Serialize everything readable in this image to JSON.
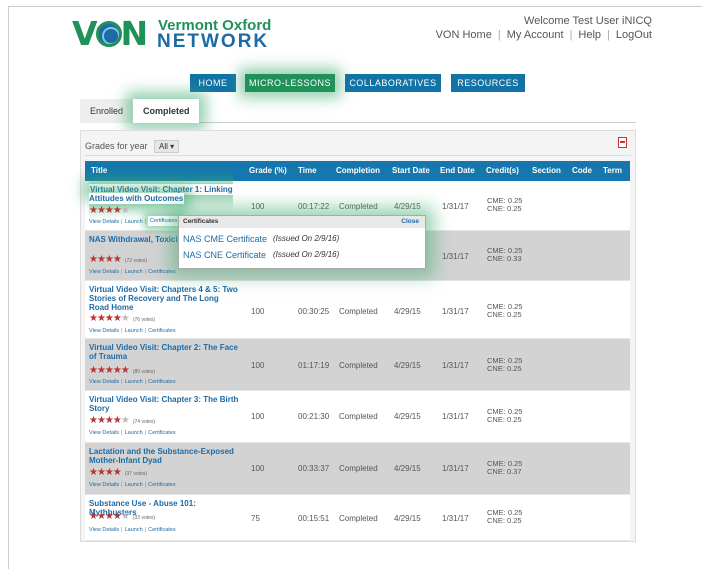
{
  "header": {
    "logo_mark": "V N",
    "logo_line1": "Vermont Oxford",
    "logo_line2": "NETWORK",
    "welcome": "Welcome Test User iNICQ",
    "links": [
      "VON Home",
      "My Account",
      "Help",
      "LogOut"
    ]
  },
  "nav": {
    "home": "HOME",
    "micro": "MICRO-LESSONS",
    "collab": "COLLABORATIVES",
    "resources": "RESOURCES"
  },
  "tabs": {
    "enrolled": "Enrolled",
    "completed": "Completed"
  },
  "filter": {
    "label": "Grades for year",
    "selected": "All"
  },
  "table": {
    "headers": [
      "Title",
      "Grade (%)",
      "Time",
      "Completion",
      "Start Date",
      "End Date",
      "Credit(s)",
      "Section",
      "Code",
      "Term"
    ],
    "link_labels": {
      "details": "View Details",
      "launch": "Launch",
      "certificates": "Certificates"
    },
    "rows": [
      {
        "title": "Virtual Video Visit: Chapter 1: Linking Attitudes with Outcomes",
        "stars": 4,
        "votes": "",
        "grade": "100",
        "time": "00:17:22",
        "completion": "Completed",
        "start": "4/29/15",
        "end": "1/31/17",
        "cme": "CME: 0.25",
        "cne": "CNE: 0.25"
      },
      {
        "title": "NAS Withdrawal, Toxicity Confounders",
        "stars": 4,
        "votes": "(72 votes)",
        "grade": "",
        "time": "",
        "completion": "",
        "start": "",
        "end": "1/31/17",
        "cme": "CME: 0.25",
        "cne": "CNE: 0.33"
      },
      {
        "title": "Virtual Video Visit: Chapters 4 & 5: Two Stories of Recovery and The Long Road Home",
        "stars": 4,
        "votes": "(76 votes)",
        "grade": "100",
        "time": "00:30:25",
        "completion": "Completed",
        "start": "4/29/15",
        "end": "1/31/17",
        "cme": "CME: 0.25",
        "cne": "CNE: 0.25"
      },
      {
        "title": "Virtual Video Visit: Chapter 2: The Face of Trauma",
        "stars": 5,
        "votes": "(80 votes)",
        "grade": "100",
        "time": "01:17:19",
        "completion": "Completed",
        "start": "4/29/15",
        "end": "1/31/17",
        "cme": "CME: 0.25",
        "cne": "CNE: 0.25"
      },
      {
        "title": "Virtual Video Visit: Chapter 3: The Birth Story",
        "stars": 4,
        "votes": "(74 votes)",
        "grade": "100",
        "time": "00:21:30",
        "completion": "Completed",
        "start": "4/29/15",
        "end": "1/31/17",
        "cme": "CME: 0.25",
        "cne": "CNE: 0.25"
      },
      {
        "title": "Lactation and the Substance-Exposed Mother-Infant Dyad",
        "stars": 4,
        "votes": "(37 votes)",
        "grade": "100",
        "time": "00:33:37",
        "completion": "Completed",
        "start": "4/29/15",
        "end": "1/31/17",
        "cme": "CME: 0.25",
        "cne": "CNE: 0.37"
      },
      {
        "title": "Substance Use - Abuse 101: Mythbusters",
        "stars": 4,
        "votes": "(33 votes)",
        "grade": "75",
        "time": "00:15:51",
        "completion": "Completed",
        "start": "4/29/15",
        "end": "1/31/17",
        "cme": "CME: 0.25",
        "cne": "CNE: 0.25"
      }
    ]
  },
  "popup": {
    "title": "Certificates",
    "close": "Close",
    "certs": [
      {
        "name": "NAS CME Certificate",
        "issued": "(Issued On 2/9/16)"
      },
      {
        "name": "NAS CNE Certificate",
        "issued": "(Issued On 2/9/16)"
      }
    ]
  },
  "colors": {
    "brand_green": "#21915a",
    "brand_blue": "#1d6aa5",
    "nav_blue": "#1173a6",
    "header_blue": "#1577ad",
    "star_red": "#b33333"
  }
}
